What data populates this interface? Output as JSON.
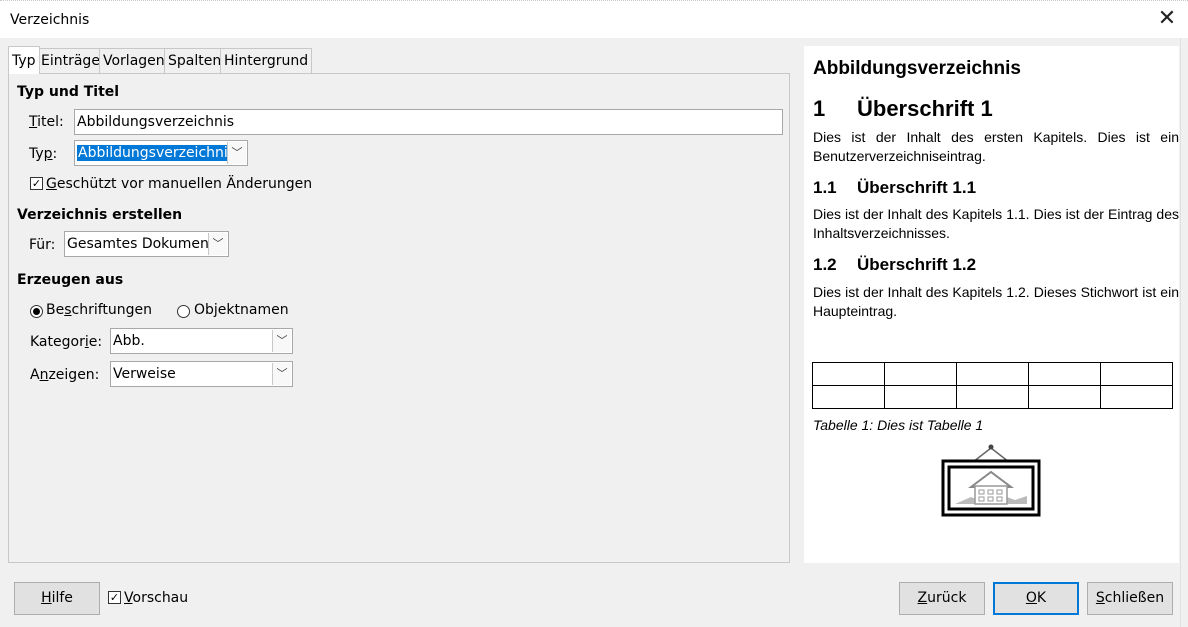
{
  "window": {
    "title": "Verzeichnis"
  },
  "tabs": [
    {
      "label": "Typ",
      "active": true
    },
    {
      "label": "Einträge"
    },
    {
      "label": "Vorlagen"
    },
    {
      "label": "Spalten"
    },
    {
      "label": "Hintergrund"
    }
  ],
  "typ_und_titel": {
    "heading": "Typ und Titel",
    "titel_label": "Titel:",
    "titel_value": "Abbildungsverzeichnis",
    "typ_label": "Typ:",
    "typ_value": "Abbildungsverzeichnis",
    "protected_label": "Geschützt vor manuellen Änderungen",
    "protected_checked": true
  },
  "verzeichnis_erstellen": {
    "heading": "Verzeichnis erstellen",
    "fuer_label": "Für:",
    "fuer_value": "Gesamtes Dokument"
  },
  "erzeugen_aus": {
    "heading": "Erzeugen aus",
    "radio_beschriftungen": "Beschriftungen",
    "radio_objektnamen": "Objektnamen",
    "selected": "Beschriftungen",
    "kategorie_label": "Kategorie:",
    "kategorie_value": "Abb.",
    "anzeigen_label": "Anzeigen:",
    "anzeigen_value": "Verweise"
  },
  "preview": {
    "toc_title": "Abbildungsverzeichnis",
    "h1_num": "1",
    "h1_text": "Überschrift 1",
    "p1": "Dies ist der Inhalt des ersten Kapitels. Dies ist ein Benutzerverzeichniseintrag.",
    "h11_num": "1.1",
    "h11_text": "Überschrift 1.1",
    "p11": "Dies ist der Inhalt des Kapitels 1.1. Dies ist der Eintrag des Inhaltsverzeichnisses.",
    "h12_num": "1.2",
    "h12_text": "Überschrift 1.2",
    "p12": "Dies ist der Inhalt des Kapitels 1.2. Dieses Stichwort ist ein Haupteintrag.",
    "table_caption": "Tabelle 1: Dies ist Tabelle 1"
  },
  "buttons": {
    "help": "Hilfe",
    "preview_label": "Vorschau",
    "preview_checked": true,
    "back": "Zurück",
    "ok": "OK",
    "close": "Schließen"
  },
  "icons": {
    "close": "close-icon",
    "dropdown": "chevron-down-icon",
    "picture": "framed-picture-icon"
  },
  "colors": {
    "selection": "#0078d7",
    "default_button_border": "#0078d7"
  }
}
